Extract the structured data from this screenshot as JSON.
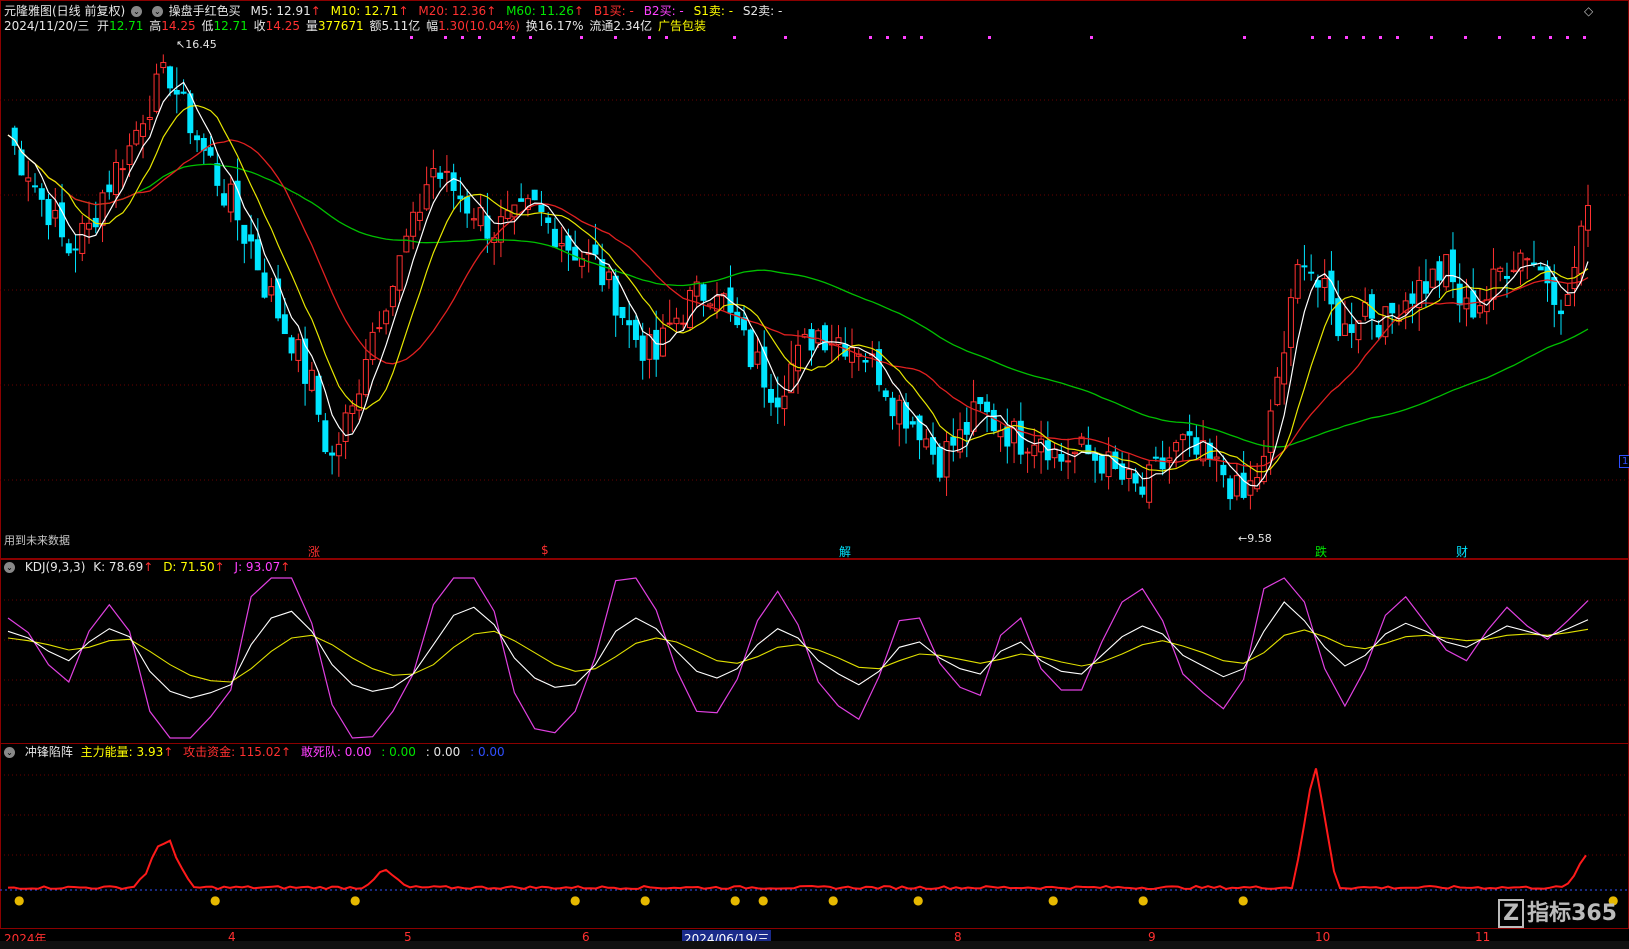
{
  "main_panel": {
    "title": "元隆雅图(日线 前复权)",
    "indicator_name": "操盘手红色买",
    "ma": [
      {
        "label": "M5: 12.91",
        "arrow": "↑",
        "color": "#ffffff"
      },
      {
        "label": "M10: 12.71",
        "arrow": "↑",
        "color": "#ffff00"
      },
      {
        "label": "M20: 12.36",
        "arrow": "↑",
        "color": "#ff3030"
      },
      {
        "label": "M60: 11.26",
        "arrow": "↑",
        "color": "#00e600"
      }
    ],
    "signals": [
      {
        "label": "B1买: -",
        "color": "#ff3030"
      },
      {
        "label": "B2买: -",
        "color": "#ff40ff"
      },
      {
        "label": "S1卖: -",
        "color": "#ffff00"
      },
      {
        "label": "S2卖: -",
        "color": "#e6e6e6"
      }
    ],
    "quote": {
      "date": "2024/11/20/三",
      "open_label": "开",
      "open": "12.71",
      "high_label": "高",
      "high": "14.25",
      "low_label": "低",
      "low": "12.71",
      "close_label": "收",
      "close": "14.25",
      "vol_label": "量",
      "vol": "377671",
      "amount_label": "额",
      "amount": "5.11亿",
      "change_label": "幅",
      "change": "1.30(10.04%)",
      "turnover_label": "换",
      "turnover": "16.17%",
      "float_label": "流通",
      "float": "2.34亿",
      "ad": "广告包装"
    },
    "high_marker": "16.45",
    "low_marker": "9.58",
    "future_note": "用到未来数据",
    "event_marks": [
      {
        "text": "涨",
        "color": "#ff3030"
      },
      {
        "text": "$",
        "color": "#ff3030"
      },
      {
        "text": "解",
        "color": "#00e5ff"
      },
      {
        "text": "跌",
        "color": "#00e600"
      },
      {
        "text": "财",
        "color": "#00e5ff"
      }
    ],
    "right_tag": "1"
  },
  "kdj_panel": {
    "name": "KDJ(9,3,3)",
    "k": "K: 78.69",
    "d": "D: 71.50",
    "j": "J: 93.07",
    "arrow": "↑"
  },
  "fight_panel": {
    "name": "冲锋陷阵",
    "main_energy": "主力能量: 3.93",
    "attack_fund": "攻击资金: 115.02",
    "arrow": "↑",
    "dare_die": "敢死队: 0.00",
    "v1": ": 0.00",
    "v2": ": 0.00",
    "v3": ": 0.00"
  },
  "time_axis": {
    "labels": [
      "2024年",
      "4",
      "5",
      "6",
      "2024/06/19/三",
      "8",
      "9",
      "10",
      "11"
    ]
  },
  "brand": "指标365",
  "colors": {
    "border": "#8b0000",
    "up": "#ff3030",
    "down": "#00e5ff",
    "ma5": "#ffffff",
    "ma10": "#ffff00",
    "ma20": "#ff3030",
    "ma60": "#00c000",
    "k": "#ffffff",
    "d": "#e0e000",
    "j": "#e040e0"
  },
  "chart_data": {
    "type": "line",
    "price_path": [
      15.3,
      14.8,
      14.2,
      13.6,
      13.9,
      14.6,
      15.1,
      15.8,
      16.2,
      15.5,
      14.9,
      14.3,
      13.7,
      12.9,
      12.3,
      11.6,
      10.5,
      11.2,
      12.4,
      13.1,
      13.9,
      14.8,
      14.5,
      14.2,
      13.9,
      14.0,
      14.2,
      13.9,
      13.6,
      13.4,
      12.9,
      12.3,
      12.0,
      12.6,
      12.9,
      13.1,
      12.4,
      11.9,
      11.5,
      12.0,
      12.4,
      12.3,
      12.2,
      11.8,
      11.3,
      11.0,
      10.5,
      10.8,
      11.2,
      11.0,
      10.8,
      10.9,
      10.5,
      10.6,
      10.5,
      10.2,
      10.0,
      10.4,
      10.7,
      10.5,
      10.3,
      9.9,
      10.4,
      12.1,
      13.6,
      12.9,
      12.4,
      12.8,
      12.5,
      12.9,
      13.1,
      13.3,
      12.7,
      12.9,
      13.4,
      13.6,
      13.2,
      12.8,
      14.25
    ],
    "kdj_k": [
      70,
      65,
      55,
      48,
      62,
      72,
      66,
      40,
      25,
      20,
      24,
      30,
      60,
      80,
      85,
      70,
      45,
      30,
      25,
      28,
      38,
      60,
      82,
      88,
      75,
      50,
      35,
      28,
      30,
      45,
      70,
      80,
      72,
      55,
      40,
      35,
      42,
      60,
      72,
      65,
      48,
      38,
      30,
      40,
      58,
      62,
      50,
      42,
      38,
      55,
      62,
      48,
      40,
      38,
      52,
      66,
      74,
      68,
      52,
      44,
      36,
      42,
      70,
      92,
      78,
      58,
      44,
      52,
      68,
      76,
      70,
      62,
      58,
      66,
      74,
      70,
      66,
      72,
      78.69
    ],
    "kdj_d": [
      65,
      63,
      60,
      56,
      58,
      63,
      64,
      55,
      45,
      37,
      33,
      32,
      42,
      55,
      65,
      67,
      60,
      50,
      42,
      37,
      38,
      45,
      58,
      68,
      70,
      63,
      54,
      45,
      40,
      42,
      51,
      61,
      65,
      62,
      55,
      48,
      46,
      51,
      58,
      60,
      56,
      50,
      43,
      42,
      48,
      53,
      52,
      49,
      46,
      49,
      53,
      51,
      47,
      44,
      47,
      53,
      60,
      63,
      59,
      54,
      48,
      46,
      54,
      67,
      71,
      66,
      59,
      57,
      61,
      66,
      67,
      65,
      63,
      64,
      67,
      68,
      67,
      69,
      71.5
    ]
  }
}
